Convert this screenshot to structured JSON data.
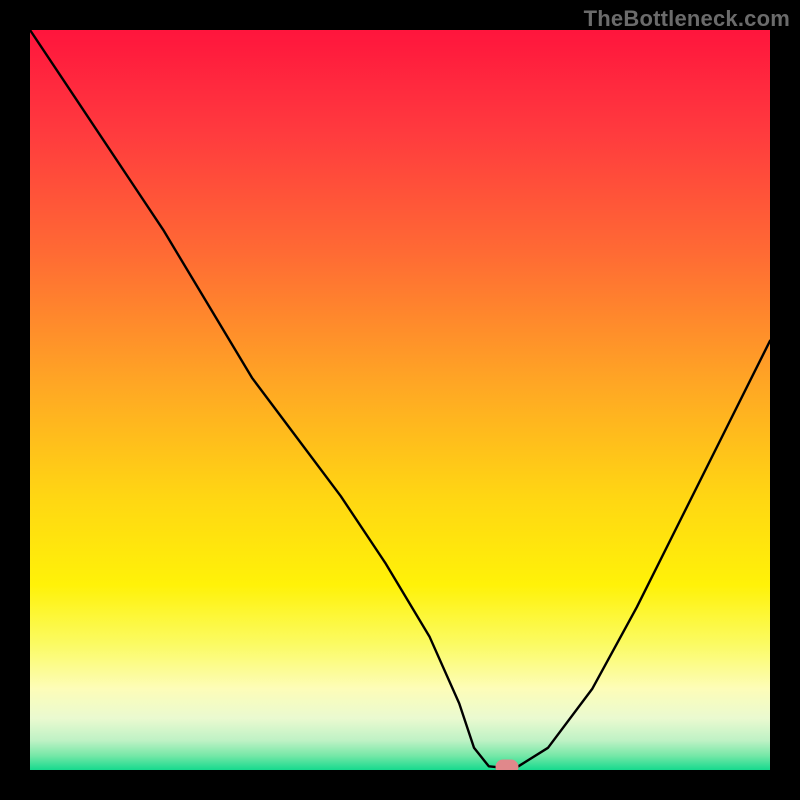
{
  "watermark": "TheBottleneck.com",
  "marker": {
    "x_pct": 64.5,
    "y_pct": 99.6,
    "color": "#e0888b"
  },
  "gradient_stops": [
    {
      "pct": 0,
      "color": "#ff153d"
    },
    {
      "pct": 14,
      "color": "#ff3b3e"
    },
    {
      "pct": 30,
      "color": "#ff6a34"
    },
    {
      "pct": 48,
      "color": "#ffa724"
    },
    {
      "pct": 63,
      "color": "#ffd613"
    },
    {
      "pct": 75,
      "color": "#fff208"
    },
    {
      "pct": 83,
      "color": "#fbfb63"
    },
    {
      "pct": 89,
      "color": "#fdfdb8"
    },
    {
      "pct": 93,
      "color": "#eafad0"
    },
    {
      "pct": 96,
      "color": "#bff2c5"
    },
    {
      "pct": 98,
      "color": "#78e8a8"
    },
    {
      "pct": 100,
      "color": "#16da8e"
    }
  ],
  "chart_data": {
    "type": "line",
    "title": "",
    "xlabel": "",
    "ylabel": "",
    "xlim": [
      0,
      100
    ],
    "ylim": [
      0,
      100
    ],
    "note": "x is normalized horizontal position (0=left edge, 100=right edge of plot); y is bottleneck severity percent (0=green/no bottleneck at bottom, 100=red/severe at top). Values estimated from pixel positions of the curve.",
    "series": [
      {
        "name": "bottleneck-curve",
        "x": [
          0,
          6,
          12,
          18,
          24,
          30,
          36,
          42,
          48,
          54,
          58,
          60,
          62,
          64,
          66,
          70,
          76,
          82,
          88,
          94,
          100
        ],
        "y": [
          100,
          91,
          82,
          73,
          63,
          53,
          45,
          37,
          28,
          18,
          9,
          3,
          0.5,
          0.3,
          0.5,
          3,
          11,
          22,
          34,
          46,
          58
        ]
      }
    ],
    "optimum_marker": {
      "x": 64.5,
      "y": 0.4
    }
  }
}
